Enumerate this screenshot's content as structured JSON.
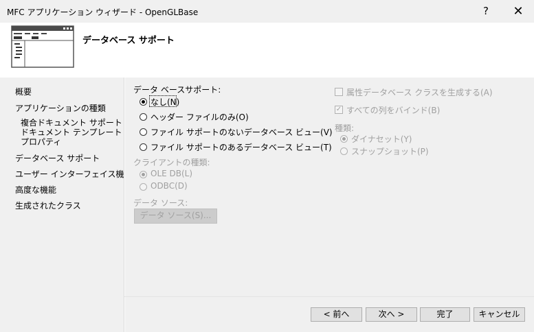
{
  "window": {
    "title": "MFC アプリケーション ウィザード - OpenGLBase",
    "help_glyph": "?",
    "close_glyph": "✕"
  },
  "header": {
    "title": "データベース サポート"
  },
  "sidebar": {
    "items": [
      {
        "label": "概要"
      },
      {
        "label": "アプリケーションの種類"
      },
      {
        "label": "複合ドキュメント サポート"
      },
      {
        "label": "ドキュメント テンプレート プロパティ"
      },
      {
        "label": "データベース サポート"
      },
      {
        "label": "ユーザー インターフェイス機能"
      },
      {
        "label": "高度な機能"
      },
      {
        "label": "生成されたクラス"
      }
    ]
  },
  "database_support": {
    "group_label": "データ ベースサポート:",
    "options": [
      {
        "label": "なし(N)",
        "checked": true
      },
      {
        "label": "ヘッダー ファイルのみ(O)",
        "checked": false
      },
      {
        "label": "ファイル サポートのないデータベース ビュー(V)",
        "checked": false
      },
      {
        "label": "ファイル サポートのあるデータベース ビュー(T)",
        "checked": false
      }
    ]
  },
  "client_type": {
    "group_label": "クライアントの種類:",
    "options": [
      {
        "label": "OLE DB(L)",
        "checked": true
      },
      {
        "label": "ODBC(D)",
        "checked": false
      }
    ]
  },
  "data_source": {
    "group_label": "データ ソース:",
    "button_label": "データ ソース(S)..."
  },
  "options_right": {
    "bind_attrs_label": "属性データベース クラスを生成する(A)",
    "bind_attrs_checked": false,
    "bind_all_label": "すべての列をバインド(B)",
    "bind_all_checked": true,
    "type_label": "種類:",
    "type_options": [
      {
        "label": "ダイナセット(Y)",
        "checked": true
      },
      {
        "label": "スナップショット(P)",
        "checked": false
      }
    ]
  },
  "footer": {
    "prev": "< 前へ",
    "next": "次へ >",
    "finish": "完了",
    "cancel": "キャンセル"
  }
}
